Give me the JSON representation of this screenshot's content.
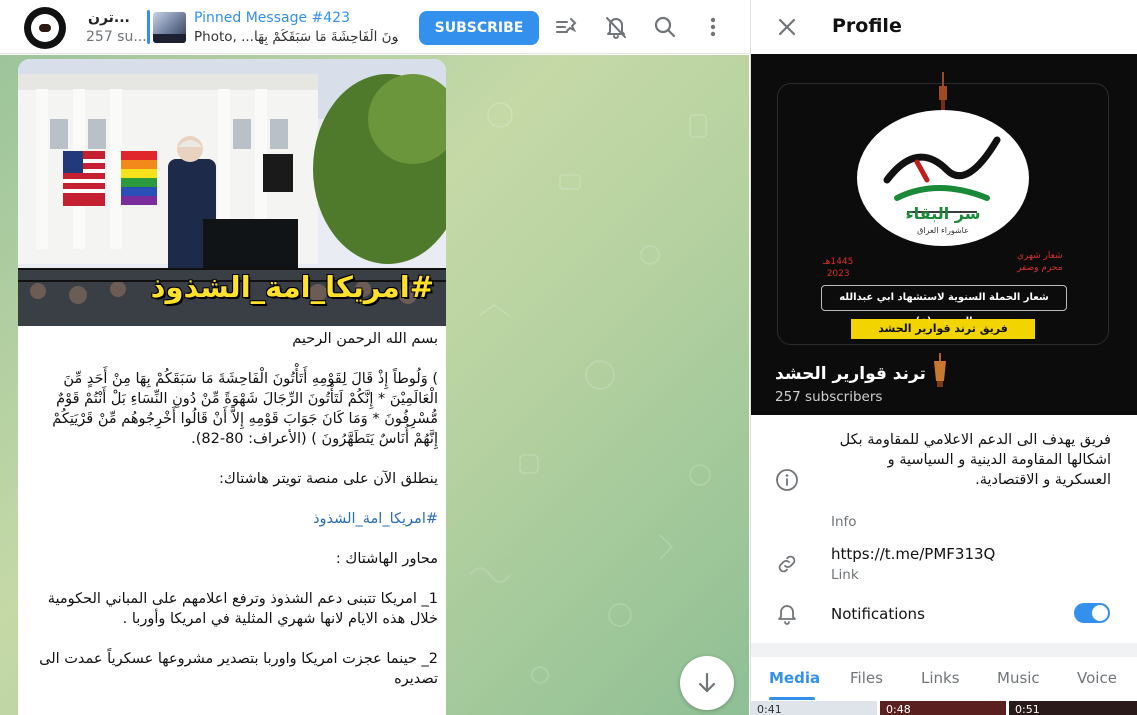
{
  "chat": {
    "title": "ترن...",
    "subscribers_short": "257 su...",
    "pinned": {
      "title": "Pinned Message #423",
      "text": "Photo, ...تُونَ الْفَاحِشَةَ مَا سَبَقَكُمْ بِهَا"
    },
    "subscribe_label": "SUBSCRIBE",
    "photo_hashtag": "#امريكا_امة_الشذوذ"
  },
  "message": {
    "lines": [
      "بسم الله الرحمن الرحيم",
      "",
      ") وَلُوطاً إِذْ قَالَ لِقَوْمِهِ أَتَأْتُونَ الْفَاحِشَةَ مَا سَبَقَكُمْ بِهَا مِنْ أَحَدٍ مِّنَ الْعَالَمِيْنَ * إِنَّكُمْ لَتَأْتُونَ الرِّجَالَ شَهْوَةً مِّنْ دُونِ النِّسَاءِ بَلْ أَنْتُمْ قَوْمٌ مُّسْرِفُونَ * وَمَا كَانَ جَوَابَ قَوْمِهِ إِلاَّ أَنْ قَالُوا أَخْرِجُوهُم مِّنْ قَرْيَتِكُمْ إِنَّهُمْ أُنَاسٌ يَتَطَهَّرُونَ ) (الأعراف: 80-82).",
      "",
      "ينطلق الآن على منصة تويتر هاشتاك:",
      "",
      "#امريكا_امة_الشذوذ",
      "",
      "محاور الهاشتاك :",
      "",
      "1_ امريكا تتبنى دعم الشذوذ وترفع اعلامهم على المباني الحكومية خلال هذه الايام لانها شهري المثلية في امريكا وأوربا .",
      "",
      "2_ حينما عجزت امريكا واوربا بتصدير مشروعها عسكرياً عمدت  الى تصديره"
    ]
  },
  "profile": {
    "header_title": "Profile",
    "name": "ترند قوارير الحشد",
    "subscribers": "257 subscribers",
    "banner": {
      "strip": "شعار الحملة السنوية لاستشهاد ابي عبدالله الحسين (ع)",
      "team": "فريق ترند قوارير الحشد",
      "left_1": "1445هـ",
      "left_2": "2023",
      "right_1": "شعار شهري",
      "right_2": "محرم وصفر",
      "logo_top": "الحسين",
      "logo_mid": "سر البقاء",
      "logo_small": "عاشوراء العراق"
    },
    "info_text": "فريق يهدف الى الدعم الاعلامي للمقاومة بكل اشكالها المقاومة الدينية و السياسية و العسكرية و الاقتصادية.",
    "info_label": "Info",
    "link_value": "https://t.me/PMF313Q",
    "link_label": "Link",
    "notifications_label": "Notifications",
    "notifications_on": true,
    "tabs": [
      "Media",
      "Files",
      "Links",
      "Music",
      "Voice"
    ],
    "active_tab": "Media",
    "media_durations": [
      "0:41",
      "0:48",
      "0:51"
    ]
  },
  "icons": {
    "header": [
      "filter-icon",
      "mute-bell-icon",
      "search-icon",
      "more-vertical-icon"
    ],
    "profile": [
      "close-icon",
      "info-icon",
      "link-icon",
      "bell-icon"
    ]
  },
  "colors": {
    "accent": "#3390ec",
    "hashtag_overlay": "#ffe12b",
    "banner_team_bg": "#f2d400"
  }
}
